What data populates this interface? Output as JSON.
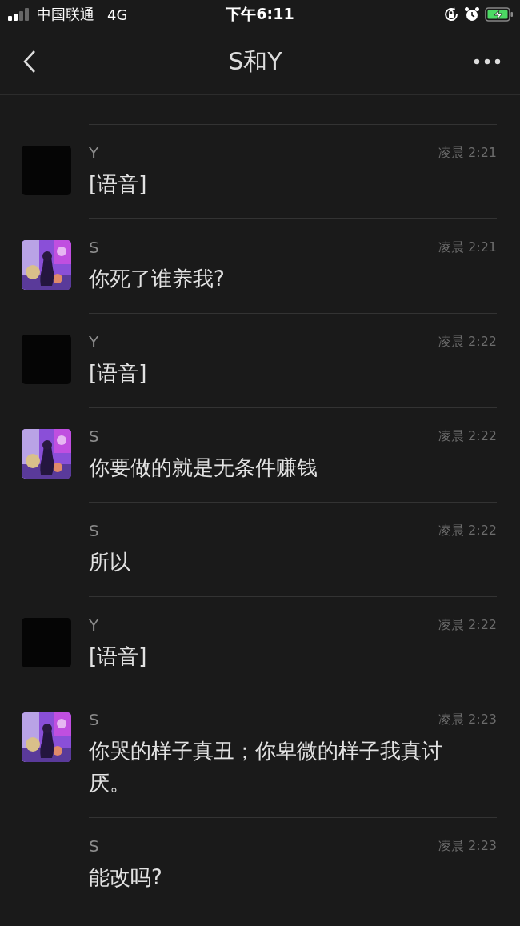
{
  "status_bar": {
    "carrier": "中国联通",
    "network": "4G",
    "time": "下午6:11"
  },
  "nav": {
    "title": "S和Y"
  },
  "messages": [
    {
      "sender": "Y",
      "time": "凌晨 2:21",
      "text": "[语音]",
      "avatar": {
        "kind": "dark"
      }
    },
    {
      "sender": "S",
      "time": "凌晨 2:21",
      "text": "你死了谁养我?"
    },
    {
      "sender": "Y",
      "time": "凌晨 2:22",
      "text": "[语音]",
      "avatar": {
        "kind": "dark"
      }
    },
    {
      "sender": "S",
      "time": "凌晨 2:22",
      "text": "你要做的就是无条件赚钱"
    },
    {
      "sender": "S",
      "time": "凌晨 2:22",
      "text": "所以"
    },
    {
      "sender": "Y",
      "time": "凌晨 2:22",
      "text": "[语音]",
      "avatar": {
        "kind": "dark"
      }
    },
    {
      "sender": "S",
      "time": "凌晨 2:23",
      "text": "你哭的样子真丑；你卑微的样子我真讨厌。"
    },
    {
      "sender": "S",
      "time": "凌晨 2:23",
      "text": "能改吗?"
    }
  ]
}
